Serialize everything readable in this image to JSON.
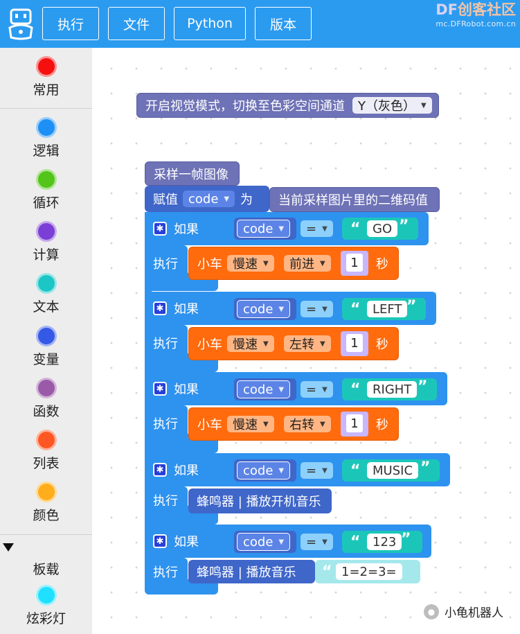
{
  "toolbar": {
    "buttons": [
      "执行",
      "文件",
      "Python",
      "版本"
    ],
    "brand_df": "DF",
    "brand_name": "创客社区",
    "brand_url": "mc.DFRobot.com.cn",
    "color": "#2b9bf0"
  },
  "sidebar": {
    "categories": [
      {
        "label": "常用",
        "color": "#f50f0f"
      },
      {
        "label": "逻辑",
        "color": "#1e90f5"
      },
      {
        "label": "循环",
        "color": "#52c41a"
      },
      {
        "label": "计算",
        "color": "#7b3ed6"
      },
      {
        "label": "文本",
        "color": "#1cc6c6"
      },
      {
        "label": "变量",
        "color": "#3559e6"
      },
      {
        "label": "函数",
        "color": "#9b5aa8"
      },
      {
        "label": "列表",
        "color": "#ff5723"
      },
      {
        "label": "颜色",
        "color": "#ffad1a"
      }
    ],
    "board_label": "板载",
    "board_item": {
      "label": "炫彩灯",
      "color": "#1fe0ff"
    }
  },
  "workspace": {
    "vision_block": "开启视觉模式，切换至色彩空间通道",
    "vision_channel": "Y（灰色）",
    "sample_block": "采样一帧图像",
    "assign_label": "赋值",
    "assign_var": "code",
    "assign_as": "为",
    "assign_value": "当前采样图片里的二维码值",
    "if_label": "如果",
    "do_label": "执行",
    "eq": "=",
    "car_label": "小车",
    "speed": "慢速",
    "seconds": "秒",
    "branches": [
      {
        "value": "GO",
        "action": "前进",
        "num": "1"
      },
      {
        "value": "LEFT",
        "action": "左转",
        "num": "1"
      },
      {
        "value": "RIGHT",
        "action": "右转",
        "num": "1"
      },
      {
        "value": "MUSIC",
        "buzzer": "蜂鸣器 | 播放开机音乐"
      },
      {
        "value": "123",
        "buzzer": "蜂鸣器 | 播放音乐",
        "notes": "1=2=3="
      }
    ]
  },
  "watermark": "小龟机器人"
}
